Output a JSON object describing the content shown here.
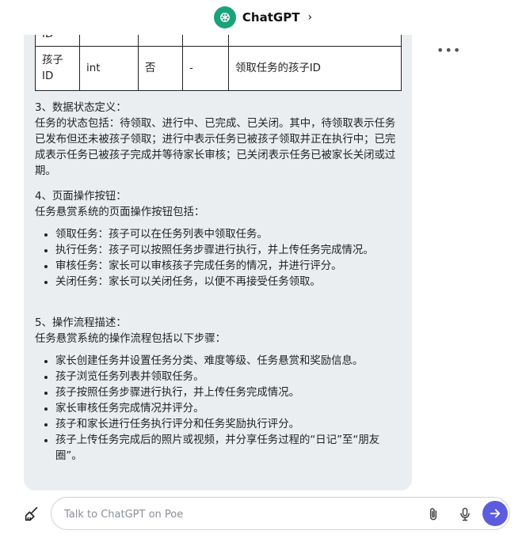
{
  "header": {
    "title": "ChatGPT",
    "chevron": "›"
  },
  "table": {
    "rows": [
      [
        "ID",
        "",
        "",
        "",
        ""
      ],
      [
        "孩子ID",
        "int",
        "否",
        "-",
        "领取任务的孩子ID"
      ]
    ]
  },
  "sections": [
    {
      "title": "3、数据状态定义：",
      "body": "任务的状态包括：待领取、进行中、已完成、已关闭。其中，待领取表示任务已发布但还未被孩子领取；进行中表示任务已被孩子领取并正在执行中；已完成表示任务已被孩子完成并等待家长审核；已关闭表示任务已被家长关闭或过期。"
    },
    {
      "title": "4、页面操作按钮：",
      "body": "任务悬赏系统的页面操作按钮包括：",
      "items": [
        "领取任务：孩子可以在任务列表中领取任务。",
        "执行任务：孩子可以按照任务步骤进行执行，并上传任务完成情况。",
        "审核任务：家长可以审核孩子完成任务的情况，并进行评分。",
        "关闭任务：家长可以关闭任务，以便不再接受任务领取。"
      ]
    },
    {
      "title": "5、操作流程描述：",
      "body": "任务悬赏系统的操作流程包括以下步骤：",
      "items": [
        "家长创建任务并设置任务分类、难度等级、任务悬赏和奖励信息。",
        "孩子浏览任务列表并领取任务。",
        "孩子按照任务步骤进行执行，并上传任务完成情况。",
        "家长审核任务完成情况并评分。",
        "孩子和家长进行任务执行评分和任务奖励执行评分。",
        "孩子上传任务完成后的照片或视频，并分享任务过程的“日记”至“朋友圈”。"
      ]
    }
  ],
  "composer": {
    "placeholder": "Talk to ChatGPT on Poe"
  },
  "colors": {
    "brand": "#19a37a",
    "send": "#5d5cde",
    "bubble": "#ebeef1"
  },
  "icons": [
    "chatgpt-logo-icon",
    "chevron-right-icon",
    "more-icon",
    "brush-icon",
    "paperclip-icon",
    "mic-icon",
    "send-arrow-icon"
  ]
}
